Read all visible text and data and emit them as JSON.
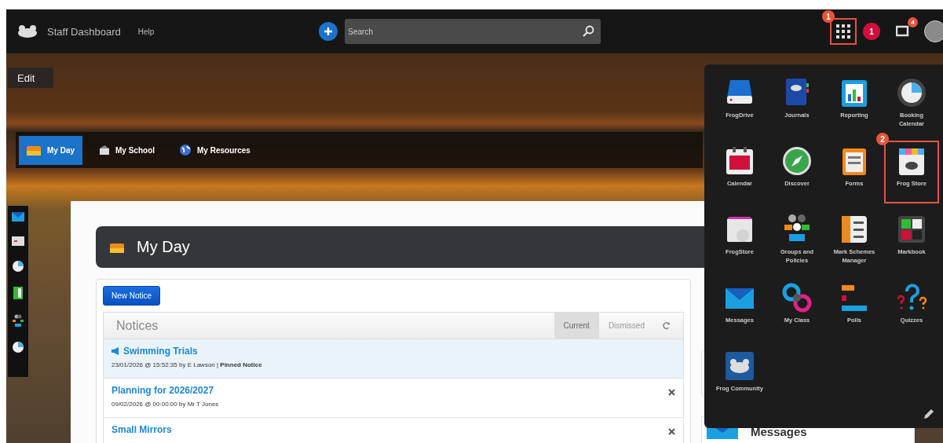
{
  "top_bar": {
    "title": "Staff Dashboard",
    "help": "Help",
    "search": {
      "placeholder": "Search"
    },
    "apps_button": {
      "highlighted": true,
      "step": "1"
    },
    "notifications": {
      "count": "1"
    },
    "messages": {
      "count": "4"
    }
  },
  "edit_button": "Edit",
  "nav_tabs": [
    {
      "label": "My Day",
      "selected": true
    },
    {
      "label": "My School",
      "selected": false
    },
    {
      "label": "My Resources",
      "selected": false
    }
  ],
  "page_title": "My Day",
  "notices": {
    "new_button": "New Notice",
    "title": "Notices",
    "tabs": [
      {
        "label": "Current",
        "selected": true
      },
      {
        "label": "Dismissed",
        "selected": false
      }
    ],
    "items": [
      {
        "title": "Swimming Trials",
        "meta": "23/01/2026 @ 15:52:35 by E Lawson | **Pinned Notice**",
        "pinned": true
      },
      {
        "title": "Planning for 2026/2027",
        "meta": "09/02/2026 @ 00:00:00 by Mr T Jones",
        "pinned": false
      },
      {
        "title": "Small Mirrors",
        "pinned": false
      }
    ]
  },
  "messages_widget": {
    "title": "Messages"
  },
  "app_menu": {
    "apps": [
      {
        "label": "FrogDrive",
        "highlighted": false
      },
      {
        "label": "Journals",
        "highlighted": false
      },
      {
        "label": "Reporting",
        "highlighted": false
      },
      {
        "label": "Booking Calendar",
        "highlighted": false
      },
      {
        "label": "Calendar",
        "highlighted": false
      },
      {
        "label": "Discover",
        "highlighted": false
      },
      {
        "label": "Forms",
        "highlighted": false
      },
      {
        "label": "Frog Store",
        "highlighted": true,
        "step": "2"
      },
      {
        "label": "FrogStore",
        "highlighted": false
      },
      {
        "label": "Groups and Policies",
        "highlighted": false
      },
      {
        "label": "Mark Schemes Manager",
        "highlighted": false
      },
      {
        "label": "Markbook",
        "highlighted": false
      },
      {
        "label": "Messages",
        "highlighted": false
      },
      {
        "label": "My Class",
        "highlighted": false
      },
      {
        "label": "Polls",
        "highlighted": false
      },
      {
        "label": "Quizzes",
        "highlighted": false
      },
      {
        "label": "Frog Community",
        "highlighted": false
      }
    ]
  }
}
